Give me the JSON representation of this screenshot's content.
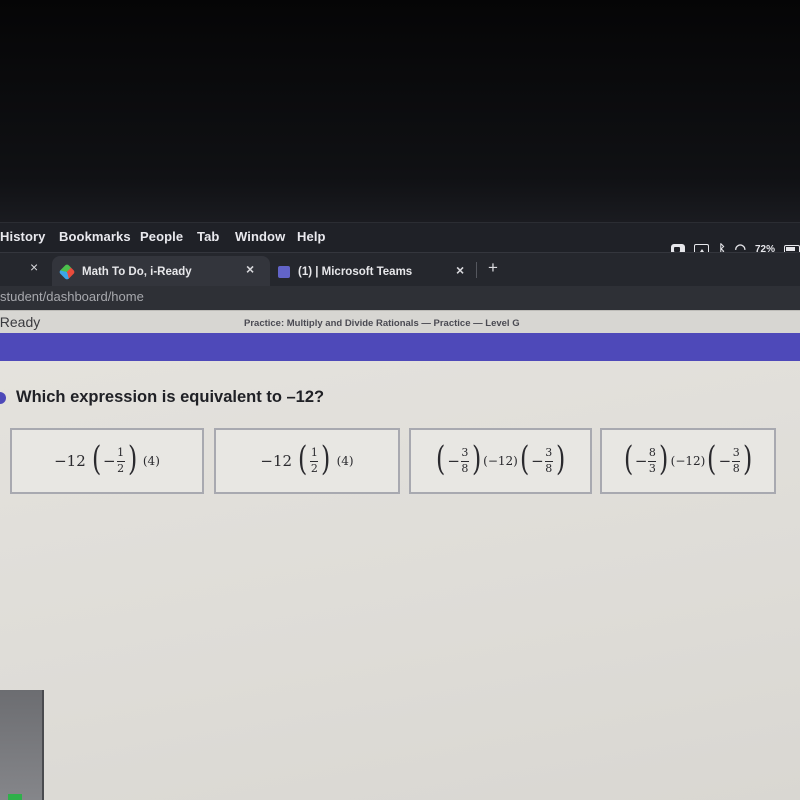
{
  "menubar": {
    "items": [
      "History",
      "Bookmarks",
      "People",
      "Tab",
      "Window",
      "Help"
    ],
    "battery_percent": "72%",
    "status_icons": [
      "video-camera-icon",
      "airplay-icon",
      "bluetooth-icon",
      "wifi-icon",
      "battery-icon"
    ]
  },
  "tabs": [
    {
      "label": "Math To Do, i-Ready",
      "icon": "iready-cube-icon",
      "active": true
    },
    {
      "label": "(1) | Microsoft Teams",
      "icon": "teams-icon",
      "active": false
    }
  ],
  "new_tab_label": "+",
  "close_label": "×",
  "address_bar": {
    "url": "student/dashboard/home"
  },
  "app": {
    "brand": "i-Ready",
    "breadcrumb": "Practice: Multiply and Divide Rationals — Practice — Level G",
    "accent_color": "#4e49b9"
  },
  "question": {
    "text": "Which expression is equivalent to –12?",
    "choices": [
      {
        "id": "A",
        "expression": "−12 (−1/2) (4)",
        "parts": {
          "lead": "−12",
          "sign": "−",
          "num": "1",
          "den": "2",
          "tail": "(4)"
        }
      },
      {
        "id": "B",
        "expression": "−12 (1/2) (4)",
        "parts": {
          "lead": "−12",
          "sign": "",
          "num": "1",
          "den": "2",
          "tail": "(4)"
        }
      },
      {
        "id": "C",
        "expression": "(−3/8) (−12) (−3/8)",
        "parts": {
          "sign1": "−",
          "num1": "3",
          "den1": "8",
          "mid": "(−12)",
          "sign2": "−",
          "num2": "3",
          "den2": "8"
        }
      },
      {
        "id": "D",
        "expression": "(−8/3) (−12) (−3/8)",
        "parts": {
          "sign1": "−",
          "num1": "8",
          "den1": "3",
          "mid": "(−12)",
          "sign2": "−",
          "num2": "3",
          "den2": "8"
        }
      }
    ]
  }
}
